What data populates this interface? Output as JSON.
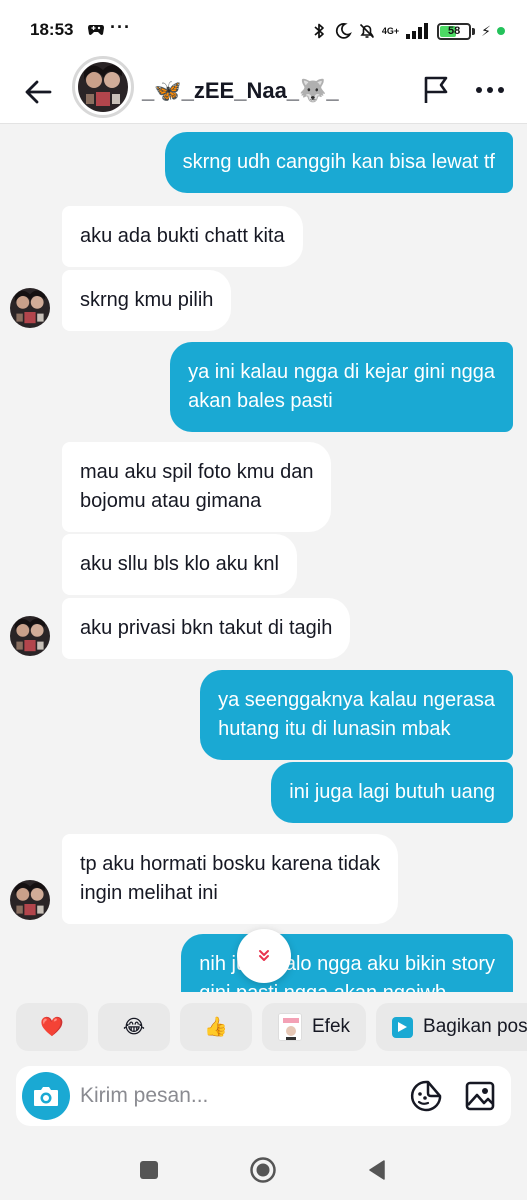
{
  "status_bar": {
    "time": "18:53",
    "dots": "···",
    "network": "4G+",
    "battery": "58",
    "battery_level": 0.58
  },
  "header": {
    "contact_name": "_🦋_zEE_Naa_🐺_"
  },
  "messages": [
    {
      "side": "out",
      "text": "skrng udh canggih kan bisa lewat tf"
    },
    {
      "side": "in",
      "text": "aku ada bukti chatt kita"
    },
    {
      "side": "in",
      "text": "skrng kmu pilih"
    },
    {
      "side": "out",
      "line1": "ya ini kalau ngga di kejar gini ngga",
      "line2": "akan bales pasti"
    },
    {
      "side": "in",
      "line1": "mau aku spil foto kmu dan",
      "line2": "bojomu atau gimana"
    },
    {
      "side": "in",
      "text": "aku sllu bls klo aku knl"
    },
    {
      "side": "in",
      "text": "aku privasi bkn takut di tagih"
    },
    {
      "side": "out",
      "line1": "ya seenggaknya kalau ngerasa",
      "line2": "hutang itu di lunasin mbak"
    },
    {
      "side": "out",
      "text": "ini juga lagi butuh uang"
    },
    {
      "side": "in",
      "line1": "tp aku hormati bosku karena tidak",
      "line2": "ingin melihat ini"
    },
    {
      "side": "out",
      "line1": "nih juga kalo ngga aku bikin story",
      "line2": "gini pasti ngga akan ngejwb"
    }
  ],
  "quick_actions": {
    "heart": "❤️",
    "laugh": "😂",
    "thumbs": "👍",
    "effects_label": "Efek",
    "share_label": "Bagikan post"
  },
  "composer": {
    "placeholder": "Kirim pesan..."
  },
  "colors": {
    "accent": "#1aa9d3",
    "background": "#f3f3f3",
    "bubble_in": "#ffffff",
    "battery_green": "#4cd964"
  }
}
